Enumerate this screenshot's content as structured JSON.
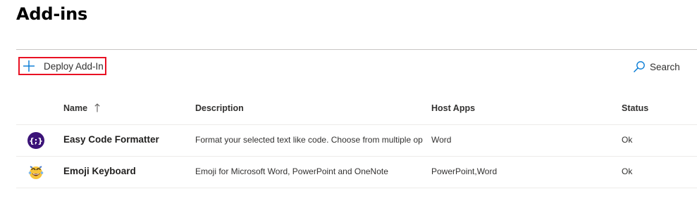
{
  "header": {
    "title": "Add-ins"
  },
  "toolbar": {
    "deploy_label": "Deploy Add-In",
    "deploy_icon": "plus-icon",
    "search_label": "Search",
    "search_icon": "search-icon",
    "accent_color": "#0078d4",
    "highlight_color": "#e81123"
  },
  "table": {
    "columns": {
      "name": "Name",
      "description": "Description",
      "host_apps": "Host Apps",
      "status": "Status"
    },
    "sort": {
      "column": "Name",
      "direction": "ascending"
    },
    "rows": [
      {
        "icon": "curly-braces-icon",
        "name": "Easy Code Formatter",
        "description": "Format your selected text like code. Choose from multiple op",
        "host_apps": "Word",
        "status": "Ok"
      },
      {
        "icon": "emoji-face-icon",
        "name": "Emoji Keyboard",
        "description": "Emoji for Microsoft Word, PowerPoint and OneNote",
        "host_apps": "PowerPoint,Word",
        "status": "Ok"
      }
    ]
  }
}
